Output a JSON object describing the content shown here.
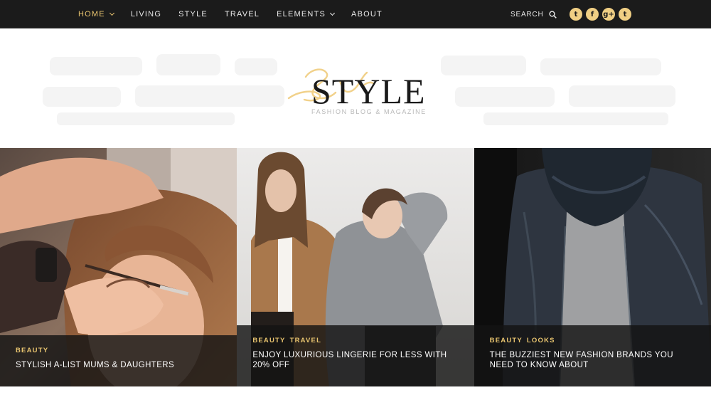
{
  "nav": {
    "items": [
      {
        "label": "HOME",
        "dropdown": true,
        "active": true
      },
      {
        "label": "LIVING",
        "dropdown": false,
        "active": false
      },
      {
        "label": "STYLE",
        "dropdown": false,
        "active": false
      },
      {
        "label": "TRAVEL",
        "dropdown": false,
        "active": false
      },
      {
        "label": "ELEMENTS",
        "dropdown": true,
        "active": false
      },
      {
        "label": "ABOUT",
        "dropdown": false,
        "active": false
      }
    ],
    "search_label": "SEARCH",
    "social": [
      {
        "icon": "twitter-icon",
        "glyph": "t"
      },
      {
        "icon": "facebook-icon",
        "glyph": "f"
      },
      {
        "icon": "google-plus-icon",
        "glyph": "g+"
      },
      {
        "icon": "tumblr-icon",
        "glyph": "t"
      }
    ]
  },
  "logo": {
    "script": "Suite",
    "title": "STYLE",
    "tagline": "FASHION BLOG & MAGAZINE"
  },
  "colors": {
    "accent": "#e8c46f",
    "nav_bg": "#1b1b1b",
    "social_bg": "#f0cf84"
  },
  "cards": [
    {
      "categories": [
        "BEAUTY"
      ],
      "title": "STYLISH A-LIST MUMS & DAUGHTERS"
    },
    {
      "categories": [
        "BEAUTY",
        "TRAVEL"
      ],
      "title": "ENJOY LUXURIOUS LINGERIE FOR LESS WITH 20% OFF"
    },
    {
      "categories": [
        "BEAUTY",
        "LOOKS"
      ],
      "title": "THE BUZZIEST NEW FASHION BRANDS YOU NEED TO KNOW ABOUT"
    }
  ]
}
